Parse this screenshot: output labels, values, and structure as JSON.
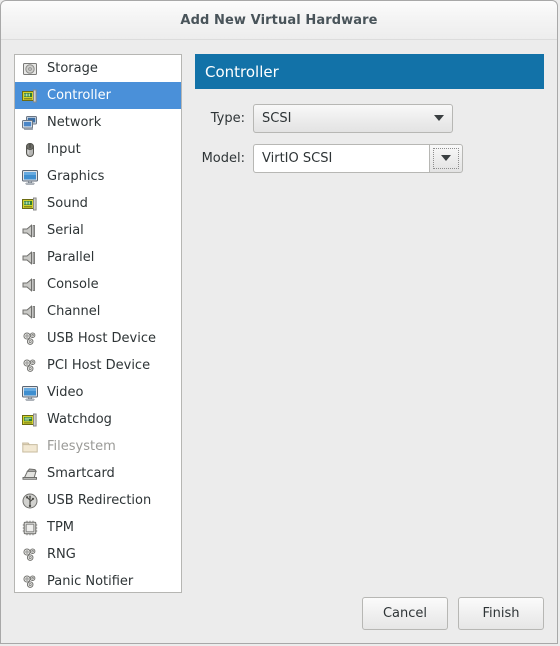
{
  "window": {
    "title": "Add New Virtual Hardware"
  },
  "sidebar": {
    "items": [
      {
        "label": "Storage",
        "icon": "storage-icon",
        "selected": false,
        "disabled": false
      },
      {
        "label": "Controller",
        "icon": "controller-card-icon",
        "selected": true,
        "disabled": false
      },
      {
        "label": "Network",
        "icon": "network-icon",
        "selected": false,
        "disabled": false
      },
      {
        "label": "Input",
        "icon": "mouse-icon",
        "selected": false,
        "disabled": false
      },
      {
        "label": "Graphics",
        "icon": "monitor-icon",
        "selected": false,
        "disabled": false
      },
      {
        "label": "Sound",
        "icon": "sound-card-icon",
        "selected": false,
        "disabled": false
      },
      {
        "label": "Serial",
        "icon": "serial-port-icon",
        "selected": false,
        "disabled": false
      },
      {
        "label": "Parallel",
        "icon": "parallel-port-icon",
        "selected": false,
        "disabled": false
      },
      {
        "label": "Console",
        "icon": "console-port-icon",
        "selected": false,
        "disabled": false
      },
      {
        "label": "Channel",
        "icon": "channel-port-icon",
        "selected": false,
        "disabled": false
      },
      {
        "label": "USB Host Device",
        "icon": "gears-icon",
        "selected": false,
        "disabled": false
      },
      {
        "label": "PCI Host Device",
        "icon": "gears-icon",
        "selected": false,
        "disabled": false
      },
      {
        "label": "Video",
        "icon": "video-monitor-icon",
        "selected": false,
        "disabled": false
      },
      {
        "label": "Watchdog",
        "icon": "watchdog-card-icon",
        "selected": false,
        "disabled": false
      },
      {
        "label": "Filesystem",
        "icon": "folder-icon",
        "selected": false,
        "disabled": true
      },
      {
        "label": "Smartcard",
        "icon": "smartcard-reader-icon",
        "selected": false,
        "disabled": false
      },
      {
        "label": "USB Redirection",
        "icon": "usb-icon",
        "selected": false,
        "disabled": false
      },
      {
        "label": "TPM",
        "icon": "chip-icon",
        "selected": false,
        "disabled": false
      },
      {
        "label": "RNG",
        "icon": "gears-icon",
        "selected": false,
        "disabled": false
      },
      {
        "label": "Panic Notifier",
        "icon": "gears-icon",
        "selected": false,
        "disabled": false
      }
    ]
  },
  "panel": {
    "header": "Controller",
    "fields": {
      "type": {
        "label": "Type:",
        "value": "SCSI"
      },
      "model": {
        "label": "Model:",
        "value": "VirtIO SCSI"
      }
    }
  },
  "footer": {
    "cancel_label": "Cancel",
    "finish_label": "Finish"
  },
  "colors": {
    "header_blue": "#1272a8",
    "selection_blue": "#4a90d9",
    "window_bg": "#ececec",
    "list_bg": "#ffffff",
    "text": "#2e3436",
    "disabled_text": "#9a9a97"
  }
}
